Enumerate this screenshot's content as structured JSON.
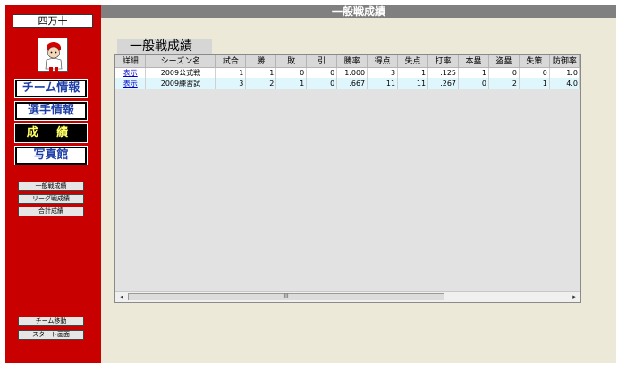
{
  "sidebar": {
    "team_name": "四万十",
    "nav": [
      {
        "label": "チーム情報",
        "style": "white"
      },
      {
        "label": "選手情報",
        "style": "white"
      },
      {
        "label": "成 績",
        "style": "black"
      },
      {
        "label": "写真館",
        "style": "white"
      }
    ],
    "sub": [
      "一般戦成績",
      "リーグ戦成績",
      "合計成績"
    ],
    "bottom": [
      "チーム移動",
      "スタート画面"
    ]
  },
  "header": {
    "title": "一般戦成績"
  },
  "main": {
    "section_title": "一般戦成績",
    "columns": [
      "詳細",
      "シーズン名",
      "試合",
      "勝",
      "敗",
      "引",
      "勝率",
      "得点",
      "失点",
      "打率",
      "本塁",
      "盗塁",
      "失策",
      "防御率"
    ],
    "rows": [
      [
        "表示",
        "2009公式戦",
        "1",
        "1",
        "0",
        "0",
        "1.000",
        "3",
        "1",
        ".125",
        "1",
        "0",
        "0",
        "1.0"
      ],
      [
        "表示",
        "2009練習試",
        "3",
        "2",
        "1",
        "0",
        ".667",
        "11",
        "11",
        ".267",
        "0",
        "2",
        "1",
        "4.0"
      ]
    ],
    "scrollbar": {
      "thumb_label": "III",
      "left_arrow": "◂",
      "right_arrow": "▸",
      "position": 0.0,
      "visible_fraction": 0.72
    }
  },
  "colors": {
    "sidebar": "#c80000",
    "topbar": "#808080",
    "main_bg": "#ece9d8",
    "row_alt": "#e0f6fd"
  }
}
